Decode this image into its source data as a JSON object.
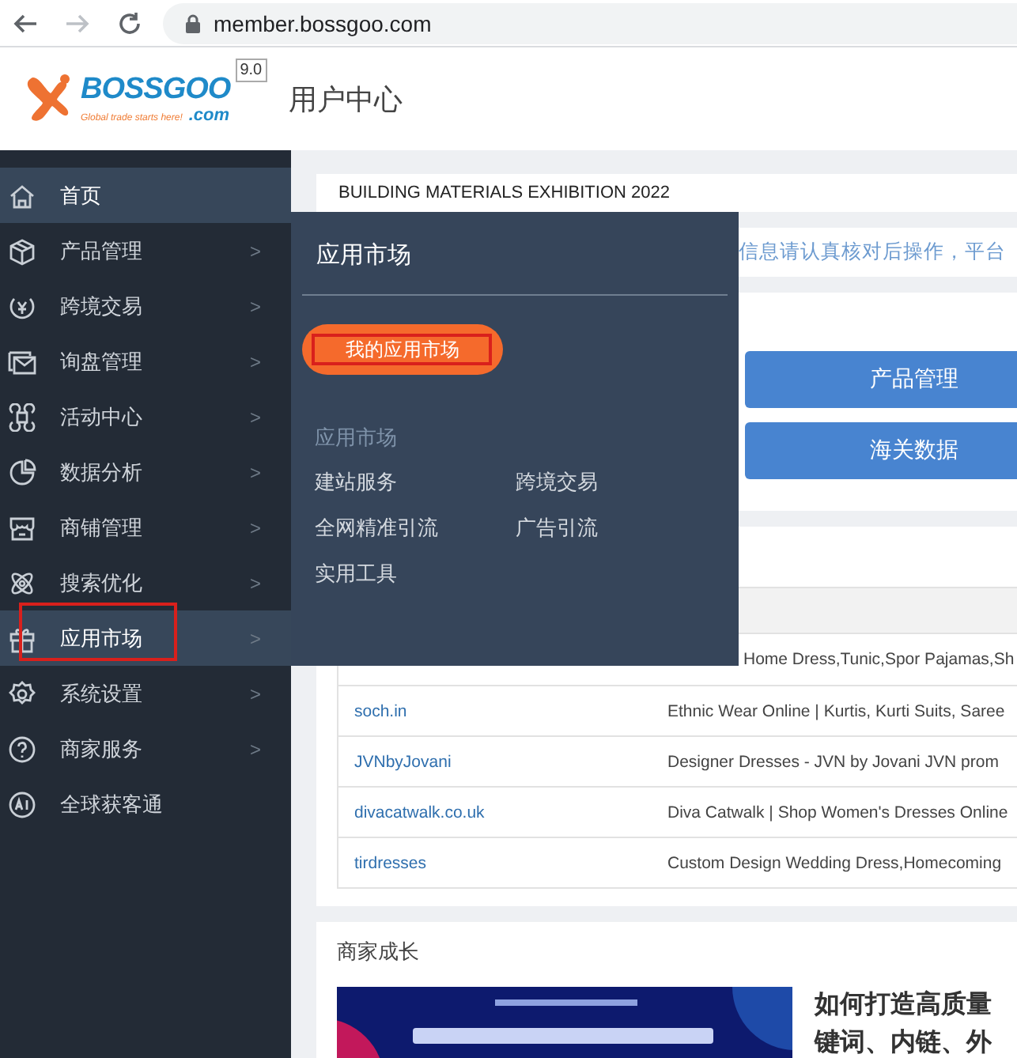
{
  "browser": {
    "url": "member.bossgoo.com",
    "forward_disabled": true
  },
  "header": {
    "logo_word": "BOSSGOO",
    "logo_tagline": "Global trade starts here!",
    "logo_suffix": ".com",
    "version": "9.0",
    "title": "用户中心"
  },
  "sidebar": {
    "items": [
      {
        "kind": "home",
        "label": "首页",
        "highlighted": true,
        "marked": false
      },
      {
        "kind": "box",
        "label": "产品管理",
        "chevron": ">",
        "highlighted": false,
        "marked": false
      },
      {
        "kind": "yen",
        "label": "跨境交易",
        "chevron": ">",
        "highlighted": false,
        "marked": false
      },
      {
        "kind": "mail",
        "label": "询盘管理",
        "chevron": ">",
        "highlighted": false,
        "marked": false
      },
      {
        "kind": "grid",
        "label": "活动中心",
        "chevron": ">",
        "highlighted": false,
        "marked": false
      },
      {
        "kind": "pie",
        "label": "数据分析",
        "chevron": ">",
        "highlighted": false,
        "marked": false
      },
      {
        "kind": "shop",
        "label": "商铺管理",
        "chevron": ">",
        "highlighted": false,
        "marked": false
      },
      {
        "kind": "atom",
        "label": "搜索优化",
        "chevron": ">",
        "highlighted": false,
        "marked": false
      },
      {
        "kind": "gift",
        "label": "应用市场",
        "chevron": ">",
        "highlighted": true,
        "marked": true
      },
      {
        "kind": "gear",
        "label": "系统设置",
        "chevron": ">",
        "highlighted": false,
        "marked": false
      },
      {
        "kind": "help",
        "label": "商家服务",
        "chevron": ">",
        "highlighted": false,
        "marked": false
      },
      {
        "kind": "ai",
        "label": "全球获客通",
        "highlighted": false,
        "marked": false
      }
    ]
  },
  "flyout": {
    "title": "应用市场",
    "button": {
      "label": "我的应用市场",
      "marked": true
    },
    "section": "应用市场",
    "links": [
      "建站服务",
      "跨境交易",
      "全网精准引流",
      "广告引流",
      "实用工具"
    ]
  },
  "main": {
    "banner": "BUILDING MATERIALS EXHIBITION 2022",
    "notice": "信息请认真核对后操作，平台",
    "buttons": [
      "产品管理",
      "海关数据"
    ],
    "table": {
      "rows": [
        {
          "title": "Home Dress,Tunic,Spor Pajamas,Sh"
        },
        {
          "site": "soch.in",
          "title": "Ethnic Wear Online | Kurtis, Kurti Suits, Saree"
        },
        {
          "site": "JVNbyJovani",
          "title": "Designer Dresses - JVN by Jovani JVN prom"
        },
        {
          "site": "divacatwalk.co.uk",
          "title": "Diva Catwalk | Shop Women's Dresses Online"
        },
        {
          "site": "tirdresses",
          "title": "Custom Design Wedding Dress,Homecoming"
        }
      ]
    },
    "growth": {
      "title": "商家成长",
      "article": {
        "kind": "picture",
        "headline": [
          "如何打造高质量",
          "键词、内链、外"
        ]
      }
    }
  }
}
